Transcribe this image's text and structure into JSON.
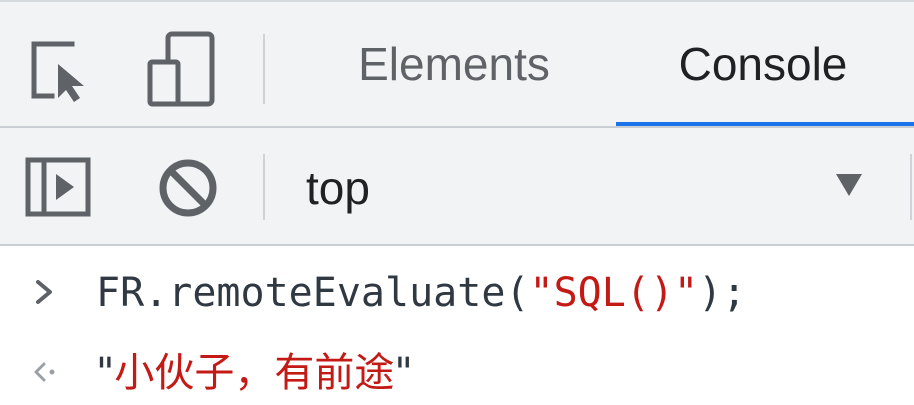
{
  "tabs": {
    "items": [
      {
        "label": "Elements",
        "active": false
      },
      {
        "label": "Console",
        "active": true
      }
    ],
    "active_color": "#1a73e8"
  },
  "toolbar": {
    "context_value": "top"
  },
  "console": {
    "input": {
      "prefix": "FR.remoteEvaluate(",
      "quote_open": "\"",
      "argument": "SQL()",
      "quote_close": "\"",
      "suffix": ");"
    },
    "result": {
      "quote_open": "\"",
      "value": "小伙子，有前途",
      "quote_close": "\""
    },
    "string_color": "#c41a16"
  },
  "icons": {
    "inspect": "inspect-element-icon",
    "device": "device-toolbar-icon",
    "sidebar": "show-sidebar-icon",
    "clear": "clear-console-icon",
    "input_prompt": "chevron-right-icon",
    "result_prompt": "result-arrow-icon",
    "dropdown": "dropdown-arrow-icon"
  }
}
